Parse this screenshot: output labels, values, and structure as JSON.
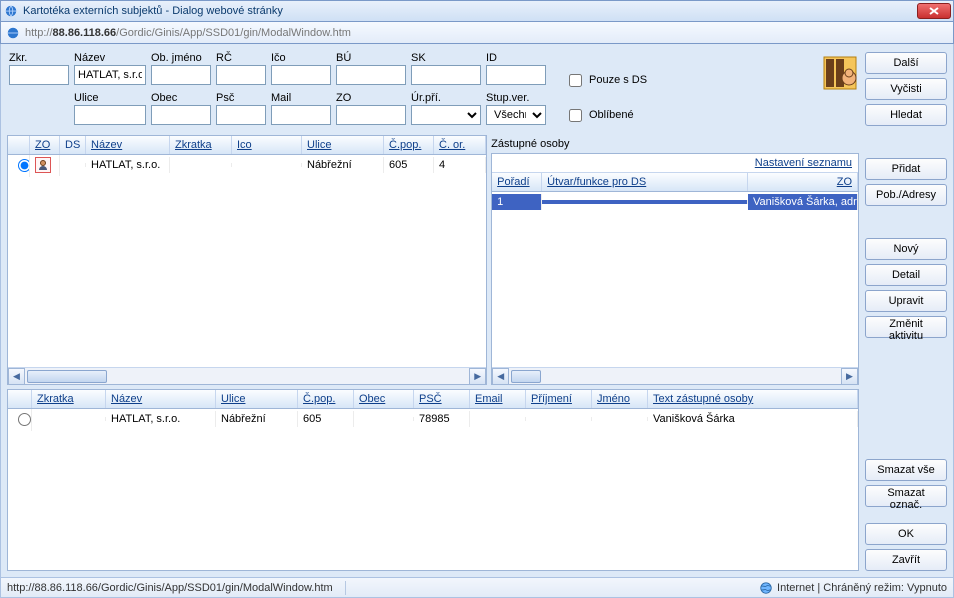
{
  "window": {
    "title": "Kartotéka externích subjektů - Dialog webové stránky"
  },
  "address": {
    "prefix1": "http://",
    "host": "88.86.118.66",
    "rest": "/Gordic/Ginis/App/SSD01/gin/ModalWindow.htm"
  },
  "form": {
    "labels": {
      "zkr": "Zkr.",
      "nazev": "Název",
      "obj": "Ob. jméno",
      "rc": "RČ",
      "ico": "Ičo",
      "bu": "BÚ",
      "sk": "SK",
      "id": "ID",
      "ulice": "Ulice",
      "obec": "Obec",
      "psc": "Psč",
      "mail": "Mail",
      "zo": "ZO",
      "urpri": "Úr.pří.",
      "stupver": "Stup.ver."
    },
    "values": {
      "nazev": "HATLAT, s.r.o.",
      "stupver": "Všechn"
    },
    "chk_ds": "Pouze s DS",
    "chk_obl": "Oblíbené"
  },
  "grid1": {
    "headers": {
      "zo": "ZO",
      "ds": "DS",
      "nazev": "Název",
      "zkr": "Zkratka",
      "ico": "Ico",
      "ulice": "Ulice",
      "cpop": "Č.pop.",
      "cor": "Č. or."
    },
    "row": {
      "nazev": "HATLAT, s.r.o.",
      "ulice": "Nábřežní",
      "cpop": "605",
      "cor": "4"
    }
  },
  "sub": {
    "title": "Zástupné osoby",
    "nastav": "Nastavení seznamu",
    "headers": {
      "poradi": "Pořadí",
      "utvar": "Útvar/funkce pro DS",
      "zo": "ZO"
    },
    "row": {
      "poradi": "1",
      "utvar": "",
      "zo": "Vanišková Šárka, adr"
    }
  },
  "grid2": {
    "headers": {
      "zkr": "Zkratka",
      "nazev": "Název",
      "ulice": "Ulice",
      "cpop": "Č.pop.",
      "obec": "Obec",
      "psc": "PSČ",
      "email": "Email",
      "prijm": "Příjmení",
      "jmeno": "Jméno",
      "text": "Text zástupné osoby"
    },
    "row": {
      "zkr": "",
      "nazev": "HATLAT, s.r.o.",
      "ulice": "Nábřežní",
      "cpop": "605",
      "obec": "",
      "psc": "78985",
      "email": "",
      "prijm": "",
      "jmeno": "",
      "text": "Vanišková Šárka"
    }
  },
  "buttons": {
    "dalsi": "Další",
    "vycisti": "Vyčisti",
    "hledat": "Hledat",
    "pridat": "Přidat",
    "pob": "Pob./Adresy",
    "novy": "Nový",
    "detail": "Detail",
    "upravit": "Upravit",
    "zmenit": "Změnit aktivitu",
    "smazatvse": "Smazat vše",
    "smazatozn": "Smazat označ.",
    "ok": "OK",
    "zavrit": "Zavřít"
  },
  "status": {
    "left": "http://88.86.118.66/Gordic/Ginis/App/SSD01/gin/ModalWindow.htm",
    "right": "Internet | Chráněný režim: Vypnuto"
  }
}
